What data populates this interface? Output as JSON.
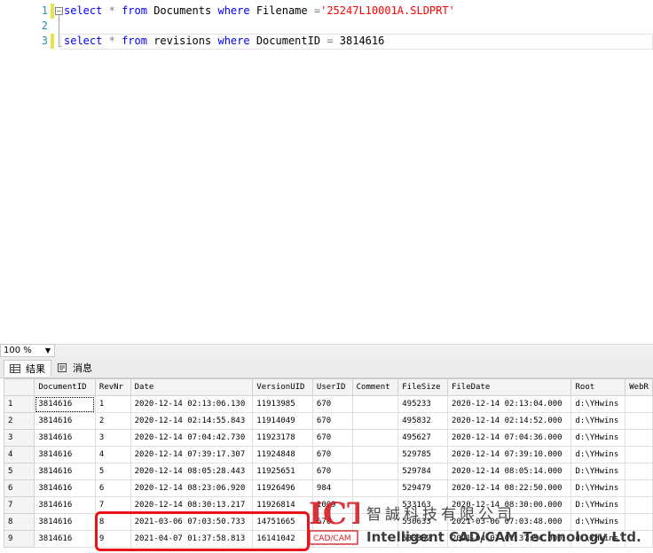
{
  "editor": {
    "lines": [
      {
        "num": "1",
        "kw1": "select",
        "op1": "*",
        "kw2": "from",
        "tbl": "Documents",
        "kw3": "where",
        "col": "Filename",
        "op2": "=",
        "val": "'25247L10001A.SLDPRT'"
      },
      {
        "num": "2"
      },
      {
        "num": "3",
        "kw1": "select",
        "op1": "*",
        "kw2": "from",
        "tbl": "revisions",
        "kw3": "where",
        "col": "DocumentID",
        "op2": "=",
        "val": "3814616"
      }
    ]
  },
  "zoom": {
    "value": "100 %"
  },
  "tabs": {
    "results": "结果",
    "messages": "消息"
  },
  "grid": {
    "columns": [
      "DocumentID",
      "RevNr",
      "Date",
      "VersionUID",
      "UserID",
      "Comment",
      "FileSize",
      "FileDate",
      "Root",
      "WebR"
    ],
    "rows": [
      [
        "1",
        "3814616",
        "1",
        "2020-12-14 02:13:06.130",
        "11913985",
        "670",
        "",
        "495233",
        "2020-12-14 02:13:04.000",
        "d:\\YHwins"
      ],
      [
        "2",
        "3814616",
        "2",
        "2020-12-14 02:14:55.843",
        "11914049",
        "670",
        "",
        "495832",
        "2020-12-14 02:14:52.000",
        "d:\\YHwins"
      ],
      [
        "3",
        "3814616",
        "3",
        "2020-12-14 07:04:42.730",
        "11923178",
        "670",
        "",
        "495627",
        "2020-12-14 07:04:36.000",
        "d:\\YHwins"
      ],
      [
        "4",
        "3814616",
        "4",
        "2020-12-14 07:39:17.307",
        "11924848",
        "670",
        "",
        "529785",
        "2020-12-14 07:39:10.000",
        "d:\\YHwins"
      ],
      [
        "5",
        "3814616",
        "5",
        "2020-12-14 08:05:28.443",
        "11925651",
        "670",
        "",
        "529784",
        "2020-12-14 08:05:14.000",
        "D:\\YHwins"
      ],
      [
        "6",
        "3814616",
        "6",
        "2020-12-14 08:23:06.920",
        "11926496",
        "984",
        "",
        "529479",
        "2020-12-14 08:22:50.000",
        "D:\\YHwins"
      ],
      [
        "7",
        "3814616",
        "7",
        "2020-12-14 08:30:13.217",
        "11926814",
        "1009",
        "",
        "533163",
        "2020-12-14 08:30:00.000",
        "D:\\YHwins"
      ],
      [
        "8",
        "3814616",
        "8",
        "2021-03-06 07:03:50.733",
        "14751665",
        "670",
        "",
        "530633",
        "2021-03-06 07:03:48.000",
        "d:\\YHwins"
      ],
      [
        "9",
        "3814616",
        "9",
        "2021-04-07 01:37:58.813",
        "16141042",
        "670",
        "",
        "533362",
        "2021-04-07 01:37:54.000",
        "d:\\YHwins"
      ]
    ]
  },
  "watermark": {
    "logo": "ICT",
    "logo_sub": "CAD/CAM",
    "cn": "智誠科技有限公司",
    "en": "Intelligent CAD/CAM Technology Ltd."
  },
  "colors": {
    "highlight_box": "#e8141a",
    "keyword": "#0000ff",
    "string": "#ff0000",
    "line_number": "#2b91af"
  }
}
